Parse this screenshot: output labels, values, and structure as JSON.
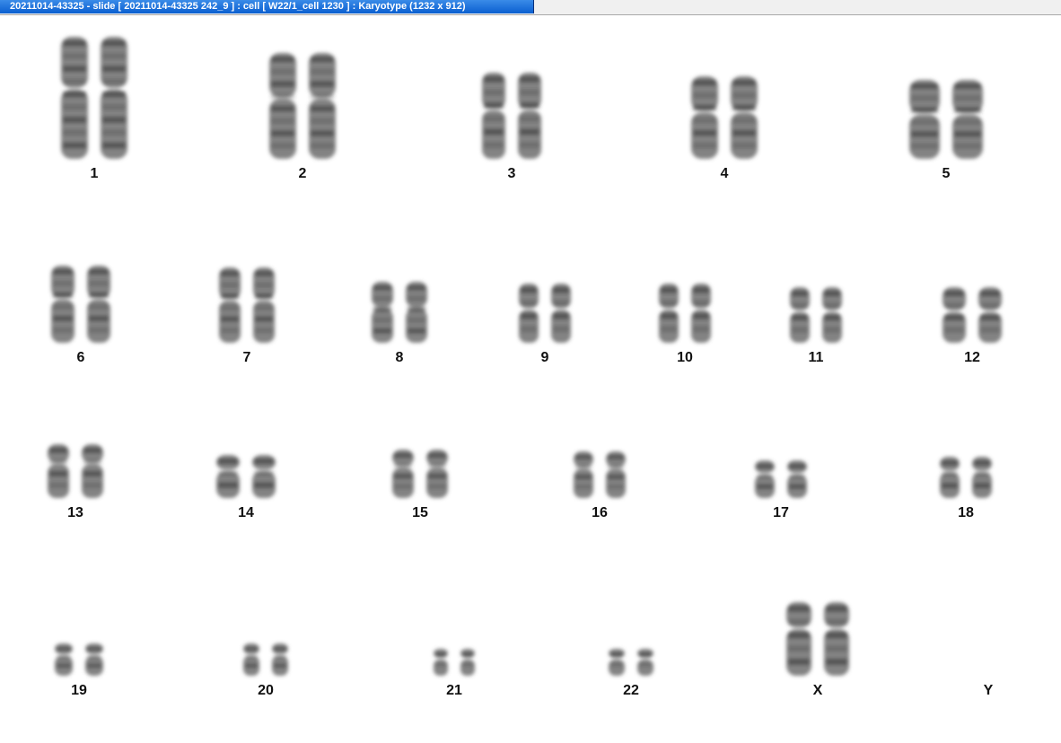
{
  "window": {
    "title": "20211014-43325 - slide [ 20211014-43325 242_9 ] : cell [ W22/1_cell 1230 ] : Karyotype  (1232 x 912)"
  },
  "karyotype": {
    "chromosomes": [
      {
        "label": "1"
      },
      {
        "label": "2"
      },
      {
        "label": "3"
      },
      {
        "label": "4"
      },
      {
        "label": "5"
      },
      {
        "label": "6"
      },
      {
        "label": "7"
      },
      {
        "label": "8"
      },
      {
        "label": "9"
      },
      {
        "label": "10"
      },
      {
        "label": "11"
      },
      {
        "label": "12"
      },
      {
        "label": "13"
      },
      {
        "label": "14"
      },
      {
        "label": "15"
      },
      {
        "label": "16"
      },
      {
        "label": "17"
      },
      {
        "label": "18"
      },
      {
        "label": "19"
      },
      {
        "label": "20"
      },
      {
        "label": "21"
      },
      {
        "label": "22"
      },
      {
        "label": "X"
      },
      {
        "label": "Y"
      }
    ]
  },
  "colors": {
    "titlebar_accent": "#0a5fd0",
    "chromosome": "#5a5a5a",
    "label": "#111111"
  }
}
